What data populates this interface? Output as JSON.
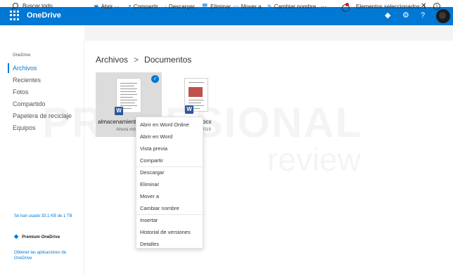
{
  "header": {
    "app_name": "OneDrive",
    "icons": [
      "waffle-icon",
      "diamond-icon",
      "gear-icon",
      "help-icon"
    ],
    "help_glyph": "?",
    "accent": "#0078d4"
  },
  "search": {
    "label": "Buscar todo"
  },
  "toolbar": {
    "open": "Abrir",
    "share": "Compartir",
    "download": "Descargar",
    "delete": "Eliminar",
    "move": "Mover a",
    "rename": "Cambiar nombre",
    "more": "···",
    "selected": "Elementos seleccionados: 1",
    "close": "✕",
    "info": "i"
  },
  "sidebar": {
    "header": "OneDrive",
    "items": [
      {
        "label": "Archivos",
        "active": true
      },
      {
        "label": "Recientes"
      },
      {
        "label": "Fotos"
      },
      {
        "label": "Compartido"
      },
      {
        "label": "Papelera de reciclaje"
      },
      {
        "label": "Equipos"
      }
    ],
    "usage": "Se han usado 33,1 KB de 1 TB",
    "premium": "Premium OneDrive",
    "get_apps": "Obtener las aplicaciones de OneDrive"
  },
  "breadcrumb": {
    "root": "Archivos",
    "separator": ">",
    "current": "Documentos"
  },
  "files": [
    {
      "name": "almacenamiento",
      "sub": "Ahora mis",
      "selected": true,
      "check_glyph": "✓",
      "word_glyph": "W"
    },
    {
      "name": "ocx",
      "sub": "019",
      "selected": false,
      "word_glyph": "W"
    }
  ],
  "watermark": {
    "line1": "PROFESIONAL",
    "line2": "review"
  },
  "context_menu": {
    "items": [
      "Abrir en Word Online",
      "Abrir en Word",
      "Vista previa",
      "Compartir",
      "Descargar",
      "Eliminar",
      "Mover a",
      "Cambiar nombre",
      "Insertar",
      "Historial de versiones",
      "Detalles"
    ]
  }
}
